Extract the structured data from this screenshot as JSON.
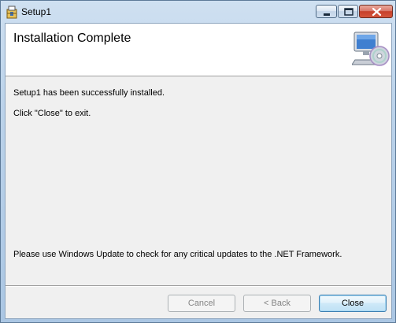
{
  "window": {
    "title": "Setup1"
  },
  "banner": {
    "heading": "Installation Complete"
  },
  "messages": {
    "installed": "Setup1 has been successfully installed.",
    "exit_hint": "Click \"Close\" to exit.",
    "update_hint": "Please use Windows Update to check for any critical updates to the .NET Framework."
  },
  "buttons": {
    "cancel": "Cancel",
    "back": "< Back",
    "close": "Close"
  },
  "icons": {
    "app": "setup-package-icon",
    "banner": "computer-cd-icon",
    "minimize": "minimize-icon",
    "maximize": "maximize-icon",
    "close": "close-x-icon"
  },
  "colors": {
    "close_accent": "#c7402b",
    "default_button_border": "#3c7fb1"
  }
}
